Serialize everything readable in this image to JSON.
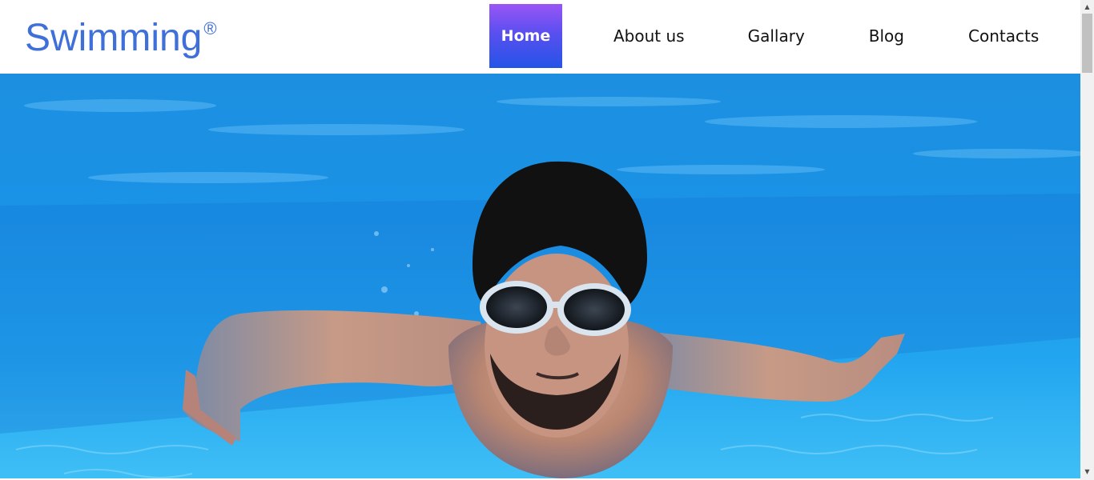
{
  "brand": {
    "name": "Swimming",
    "registered_mark": "®",
    "color": "#3f6fd8"
  },
  "nav": {
    "items": [
      {
        "label": "Home",
        "active": true
      },
      {
        "label": "About us",
        "active": false
      },
      {
        "label": "Gallary",
        "active": false
      },
      {
        "label": "Blog",
        "active": false
      },
      {
        "label": "Contacts",
        "active": false
      }
    ],
    "active_gradient": [
      "#9a55f5",
      "#2454e6"
    ]
  },
  "hero": {
    "subject": "swimmer-underwater-photo",
    "water_color": "#1c9be6"
  },
  "scrollbar": {
    "up_icon": "triangle-up-icon",
    "down_icon": "triangle-down-icon"
  }
}
